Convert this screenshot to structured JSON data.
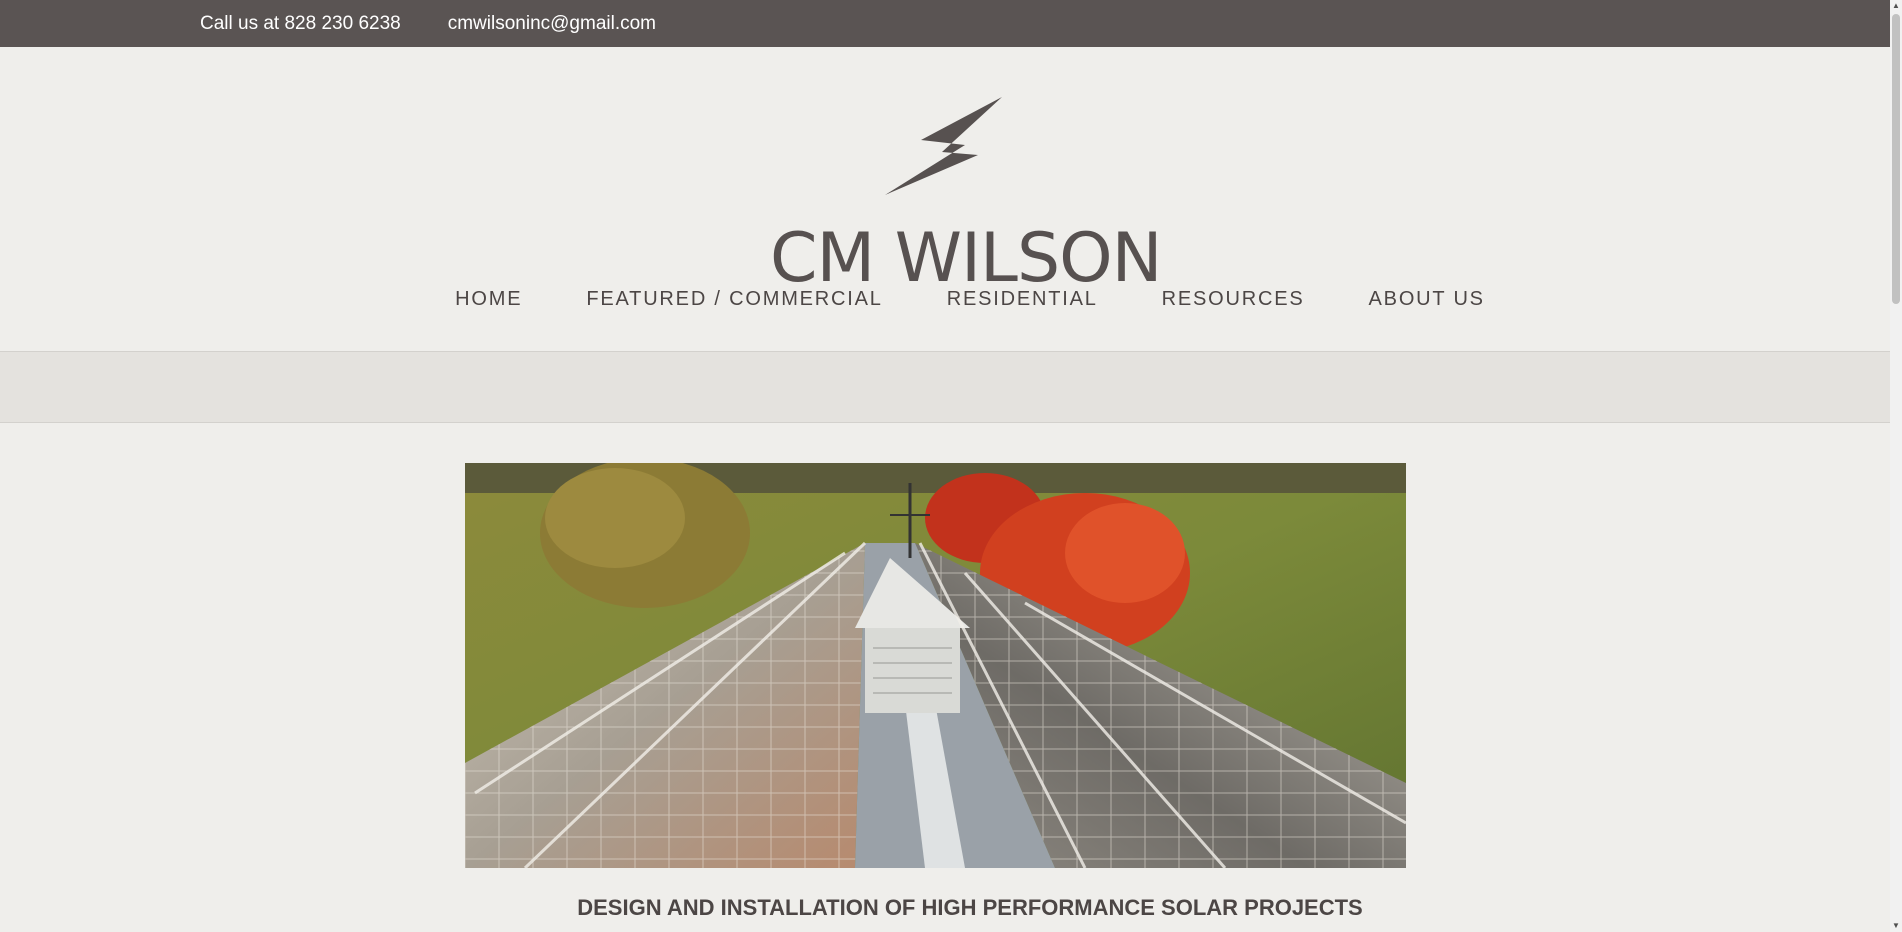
{
  "topbar": {
    "phone": "Call us at 828 230 6238",
    "email": "cmwilsoninc@gmail.com"
  },
  "logo": {
    "text": "CM WILSON",
    "icon": "lightning-bolt-icon",
    "color": "#575150"
  },
  "nav": {
    "items": [
      {
        "label": "HOME"
      },
      {
        "label": "FEATURED / COMMERCIAL"
      },
      {
        "label": "RESIDENTIAL"
      },
      {
        "label": "RESOURCES"
      },
      {
        "label": "ABOUT US"
      }
    ]
  },
  "hero": {
    "image": "solar-panel-roof-photo"
  },
  "tagline": "DESIGN AND INSTALLATION OF HIGH PERFORMANCE SOLAR PROJECTS",
  "colors": {
    "topbar_bg": "#5a5453",
    "page_bg": "#efeeeb",
    "band_bg": "#e4e2de",
    "text": "#4c4645"
  }
}
